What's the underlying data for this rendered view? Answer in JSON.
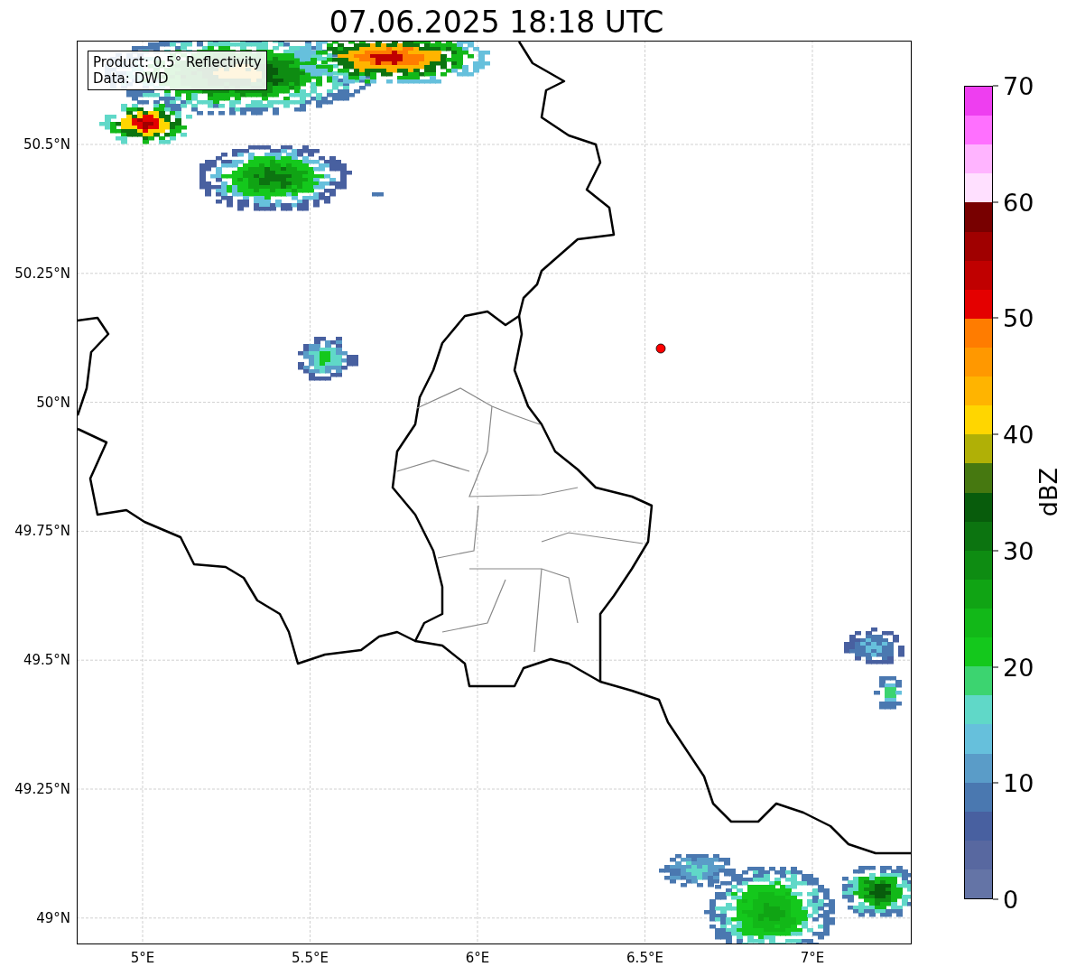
{
  "title": "07.06.2025 18:18 UTC",
  "legend": {
    "lines": [
      "Product: 0.5° Reflectivity",
      "Data: DWD"
    ]
  },
  "map": {
    "y_ticks": [
      "50.5°N",
      "50.25°N",
      "50°N",
      "49.75°N",
      "49.5°N",
      "49.25°N",
      "49°N"
    ],
    "x_ticks": [
      "5°E",
      "5.5°E",
      "6°E",
      "6.5°E",
      "7°E"
    ]
  },
  "colorbar": {
    "label": "dBZ",
    "ticks": [
      "70",
      "60",
      "50",
      "40",
      "30",
      "20",
      "10",
      "0"
    ],
    "segments": [
      {
        "color": "#ee3ef0"
      },
      {
        "color": "#ff70ff"
      },
      {
        "color": "#ffb4ff"
      },
      {
        "color": "#ffe0ff"
      },
      {
        "color": "#780000"
      },
      {
        "color": "#a00000"
      },
      {
        "color": "#c00000"
      },
      {
        "color": "#e40000"
      },
      {
        "color": "#ff7c00"
      },
      {
        "color": "#ff9800"
      },
      {
        "color": "#ffb400"
      },
      {
        "color": "#ffd600"
      },
      {
        "color": "#b0b006"
      },
      {
        "color": "#467810"
      },
      {
        "color": "#085c0c"
      },
      {
        "color": "#0c7410"
      },
      {
        "color": "#0e8c12"
      },
      {
        "color": "#10a414"
      },
      {
        "color": "#12b818"
      },
      {
        "color": "#14c81c"
      },
      {
        "color": "#3cd470"
      },
      {
        "color": "#60d8c8"
      },
      {
        "color": "#66c0dc"
      },
      {
        "color": "#5a9cc8"
      },
      {
        "color": "#4a78b0"
      },
      {
        "color": "#4860a0"
      },
      {
        "color": "#5868a0"
      },
      {
        "color": "#6474a6"
      }
    ]
  }
}
